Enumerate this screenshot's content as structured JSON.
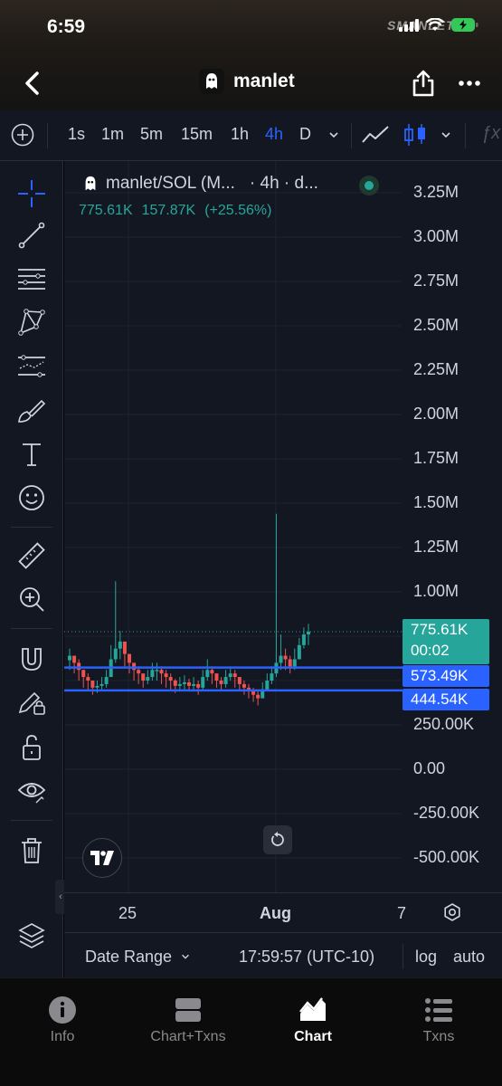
{
  "status_bar": {
    "time": "6:59",
    "watermark": "SMANLET"
  },
  "header": {
    "title": "manlet"
  },
  "timeframes": {
    "items": [
      "1s",
      "1m",
      "5m",
      "15m",
      "1h",
      "4h",
      "D"
    ],
    "active": "4h",
    "fx_label": "ƒx"
  },
  "legend": {
    "symbol": "manlet/SOL (M...",
    "meta": "· 4h · d...",
    "last": "775.61K",
    "change": "157.87K",
    "change_pct": "(+25.56%)"
  },
  "price_axis": {
    "labels": [
      "3.25M",
      "3.00M",
      "2.75M",
      "2.50M",
      "2.25M",
      "2.00M",
      "1.75M",
      "1.50M",
      "1.25M",
      "1.00M",
      "250.00K",
      "0.00",
      "-250.00K",
      "-500.00K"
    ]
  },
  "price_tags": {
    "current": "775.61K",
    "countdown": "00:02",
    "line1": "573.49K",
    "line2": "444.54K"
  },
  "time_axis": {
    "labels": [
      "25",
      "Aug",
      "7"
    ]
  },
  "bottom_toolbar": {
    "date_range": "Date Range",
    "clock": "17:59:57 (UTC-10)",
    "log": "log",
    "auto": "auto"
  },
  "tabs": [
    {
      "label": "Info",
      "icon": "info-icon"
    },
    {
      "label": "Chart+Txns",
      "icon": "split-view-icon"
    },
    {
      "label": "Chart",
      "icon": "area-chart-icon"
    },
    {
      "label": "Txns",
      "icon": "list-icon"
    }
  ],
  "active_tab": "Chart",
  "colors": {
    "up": "#26a69a",
    "down": "#ef5350",
    "accent": "#2962ff",
    "bg": "#131722"
  },
  "chart_data": {
    "type": "candlestick",
    "title": "manlet/SOL",
    "ylim": [
      -500000,
      3250000
    ],
    "y_ticks": [
      3250000,
      3000000,
      2750000,
      2500000,
      2250000,
      2000000,
      1750000,
      1500000,
      1250000,
      1000000,
      250000,
      0,
      -250000,
      -500000
    ],
    "current_price": 775610,
    "horizontal_lines": [
      573490,
      444540
    ],
    "x_labels": [
      "25",
      "Aug",
      "7"
    ],
    "closes": [
      640000,
      600000,
      560000,
      520000,
      500000,
      460000,
      470000,
      480000,
      520000,
      620000,
      680000,
      720000,
      650000,
      600000,
      560000,
      540000,
      500000,
      520000,
      560000,
      560000,
      540000,
      520000,
      500000,
      470000,
      480000,
      490000,
      470000,
      480000,
      460000,
      520000,
      560000,
      540000,
      500000,
      480000,
      520000,
      540000,
      520000,
      480000,
      460000,
      440000,
      420000,
      400000,
      450000,
      500000,
      540000,
      600000,
      640000,
      620000,
      580000,
      620000,
      700000,
      760000,
      775610
    ],
    "highs": [
      680000,
      640000,
      620000,
      560000,
      540000,
      500000,
      500000,
      520000,
      560000,
      700000,
      1060000,
      780000,
      700000,
      640000,
      600000,
      580000,
      540000,
      560000,
      600000,
      600000,
      580000,
      560000,
      540000,
      510000,
      520000,
      530000,
      510000,
      520000,
      500000,
      560000,
      620000,
      580000,
      540000,
      520000,
      560000,
      580000,
      560000,
      520000,
      500000,
      480000,
      460000,
      440000,
      490000,
      540000,
      580000,
      1440000,
      760000,
      680000,
      640000,
      680000,
      740000,
      800000,
      820000
    ],
    "lows": [
      560000,
      540000,
      500000,
      460000,
      440000,
      420000,
      430000,
      440000,
      460000,
      540000,
      600000,
      620000,
      580000,
      540000,
      500000,
      480000,
      460000,
      480000,
      500000,
      500000,
      480000,
      460000,
      440000,
      430000,
      440000,
      450000,
      440000,
      440000,
      420000,
      440000,
      500000,
      480000,
      460000,
      440000,
      460000,
      500000,
      460000,
      440000,
      420000,
      400000,
      380000,
      360000,
      400000,
      440000,
      480000,
      520000,
      560000,
      560000,
      540000,
      560000,
      620000,
      680000,
      700000
    ]
  }
}
